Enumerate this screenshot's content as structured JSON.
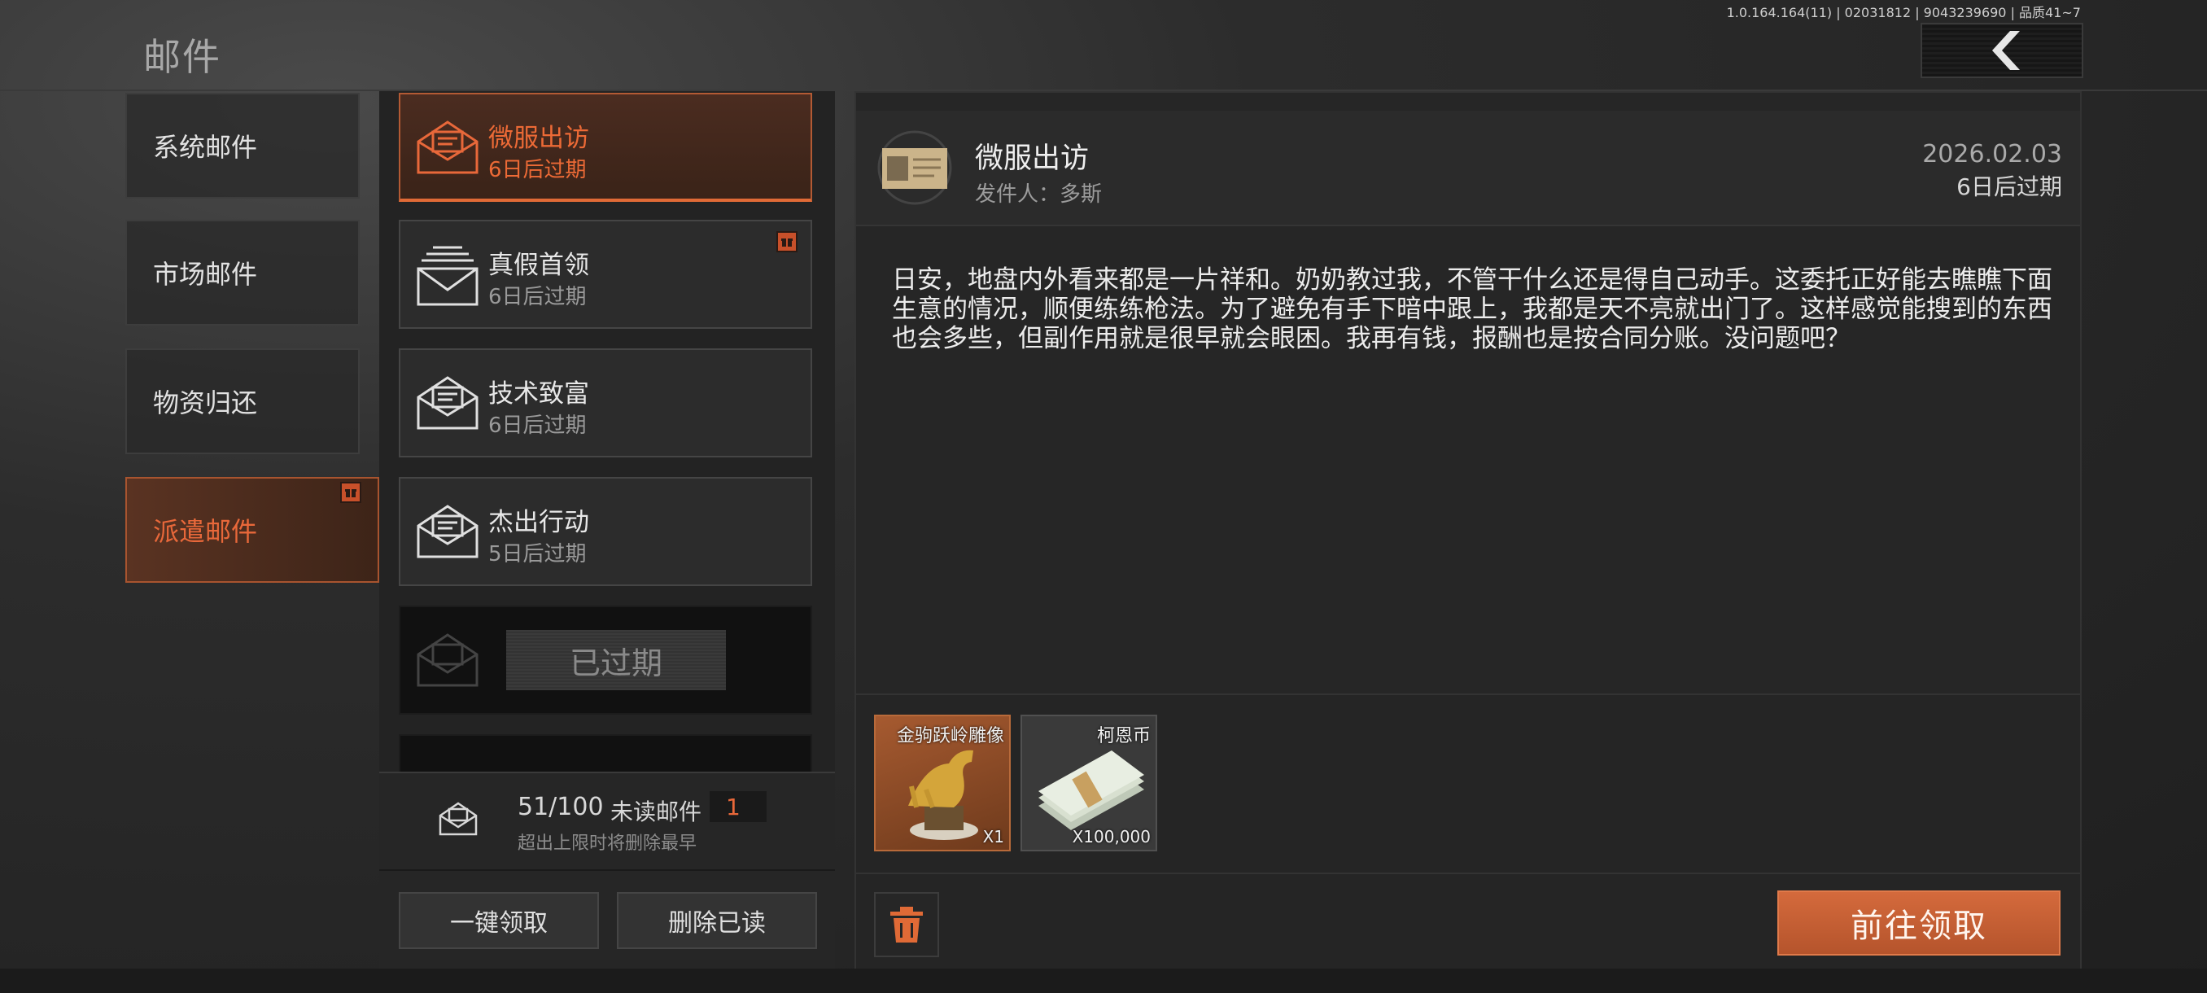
{
  "header": {
    "title": "邮件",
    "version_info": "1.0.164.164(11) | 02031812 | 9043239690 | 品质41~7",
    "back_icon": "chevron-left-icon"
  },
  "categories": [
    {
      "label": "系统邮件",
      "active": false
    },
    {
      "label": "市场邮件",
      "active": false
    },
    {
      "label": "物资归还",
      "active": false
    },
    {
      "label": "派遣邮件",
      "active": true,
      "badge": "gift-icon"
    }
  ],
  "mails": [
    {
      "title": "微服出访",
      "expiry": "6日后过期",
      "active": true
    },
    {
      "title": "真假首领",
      "expiry": "6日后过期",
      "badge": "gift-icon"
    },
    {
      "title": "技术致富",
      "expiry": "6日后过期"
    },
    {
      "title": "杰出行动",
      "expiry": "5日后过期"
    },
    {
      "expired_label": "已过期"
    }
  ],
  "mail_count": {
    "count": "51/100",
    "unread_label": "未读邮件",
    "unread_count": "1",
    "note": "超出上限时将删除最早"
  },
  "bottom_buttons": {
    "claim_all": "一键领取",
    "delete_read": "删除已读"
  },
  "detail": {
    "title": "微服出访",
    "sender": "发件人：多斯",
    "date": "2026.02.03",
    "expiry": "6日后过期",
    "body": "日安，地盘内外看来都是一片祥和。奶奶教过我，不管干什么还是得自己动手。这委托正好能去瞧瞧下面生意的情况，顺便练练枪法。为了避免有手下暗中跟上，我都是天不亮就出门了。这样感觉能搜到的东西也会多些，但副作用就是很早就会眼困。我再有钱，报酬也是按合同分账。没问题吧？",
    "rewards": [
      {
        "name": "金驹跃岭雕像",
        "qty": "X1"
      },
      {
        "name": "柯恩币",
        "qty": "X100,000"
      }
    ],
    "claim_button": "前往领取",
    "delete_icon": "trash-icon"
  },
  "colors": {
    "accent": "#e8683a",
    "button_orange": "#c45e34",
    "panel": "#262626"
  }
}
